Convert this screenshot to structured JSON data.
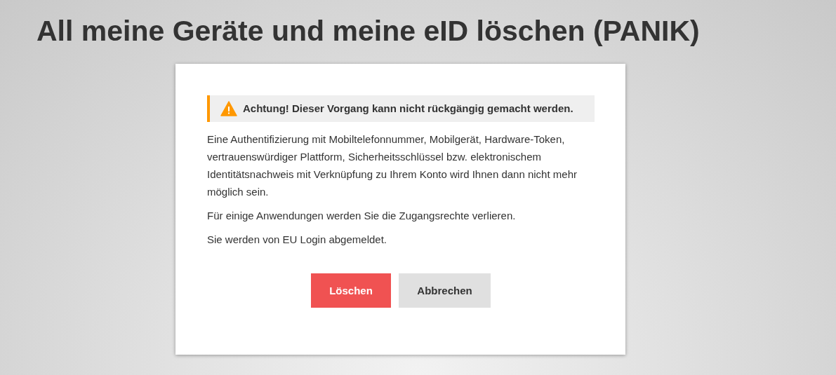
{
  "title": "All meine Geräte und meine eID löschen (PANIK)",
  "dialog": {
    "warning": "Achtung! Dieser Vorgang kann nicht rückgängig gemacht werden.",
    "paragraphs": [
      "Eine Authentifizierung mit Mobiltelefonnummer, Mobilgerät, Hardware-Token, vertrauenswürdiger Plattform, Sicherheitsschlüssel bzw. elektronischem Identitätsnachweis mit Verknüpfung zu Ihrem Konto wird Ihnen dann nicht mehr möglich sein.",
      "Für einige Anwendungen werden Sie die Zugangsrechte verlieren.",
      "Sie werden von EU Login abgemeldet."
    ],
    "buttons": [
      {
        "label": "Löschen",
        "kind": "danger"
      },
      {
        "label": "Abbrechen",
        "kind": "secondary"
      }
    ]
  }
}
